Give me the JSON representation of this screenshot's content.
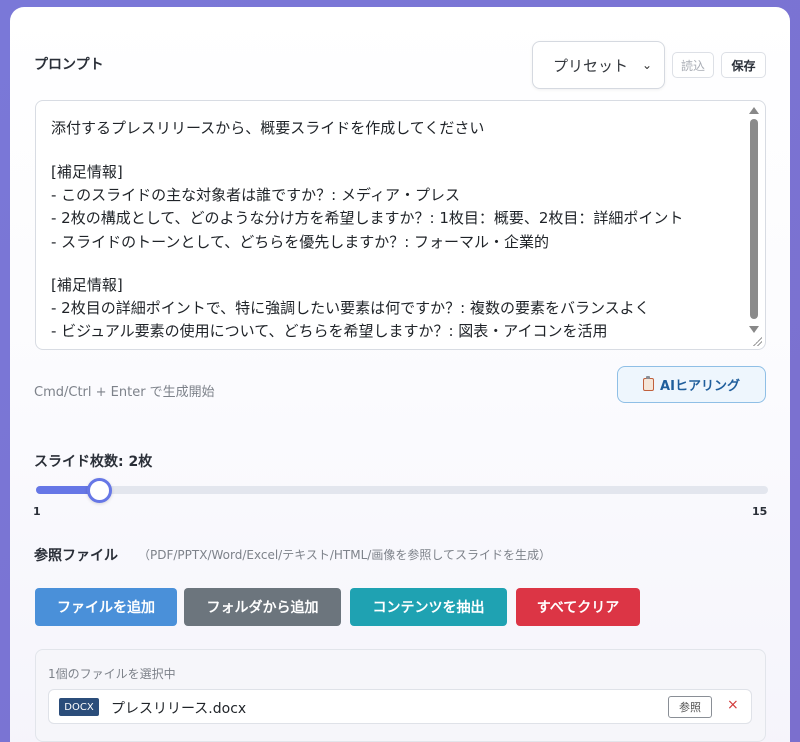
{
  "prompt": {
    "label": "プロンプト",
    "preset_value": "プリセット",
    "load_label": "読込",
    "save_label": "保存",
    "lines": [
      "添付するプレスリリースから、概要スライドを作成してください",
      "",
      "[補足情報]",
      "- このスライドの主な対象者は誰ですか？: メディア・プレス",
      "- 2枚の構成として、どのような分け方を希望しますか？: 1枚目：概要、2枚目：詳細ポイント",
      "- スライドのトーンとして、どちらを優先しますか？: フォーマル・企業的",
      "",
      "[補足情報]",
      "- 2枚目の詳細ポイントで、特に強調したい要素は何ですか？: 複数の要素をバランスよく",
      "- ビジュアル要素の使用について、どちらを希望しますか？: 図表・アイコンを活用"
    ],
    "hint": "Cmd/Ctrl + Enter で生成開始",
    "ai_button_label": "AIヒアリング"
  },
  "slides": {
    "label": "スライド枚数: 2枚",
    "value": 2,
    "min": 1,
    "max": 15,
    "min_label": "1",
    "max_label": "15"
  },
  "reference": {
    "label": "参照ファイル",
    "sublabel": "（PDF/PPTX/Word/Excel/テキスト/HTML/画像を参照してスライドを生成）",
    "buttons": {
      "add": "ファイルを追加",
      "folder": "フォルダから追加",
      "extract": "コンテンツを抽出",
      "clear": "すべてクリア"
    },
    "selected_count": "1個のファイルを選択中",
    "files": [
      {
        "type": "DOCX",
        "name": "プレスリリース.docx",
        "ref_label": "参照",
        "remove": "×"
      }
    ]
  },
  "colors": {
    "slider": "#6677e6",
    "add": "#4a90d9",
    "folder": "#6c757d",
    "extract": "#1fa2b2",
    "clear": "#dc3545"
  }
}
